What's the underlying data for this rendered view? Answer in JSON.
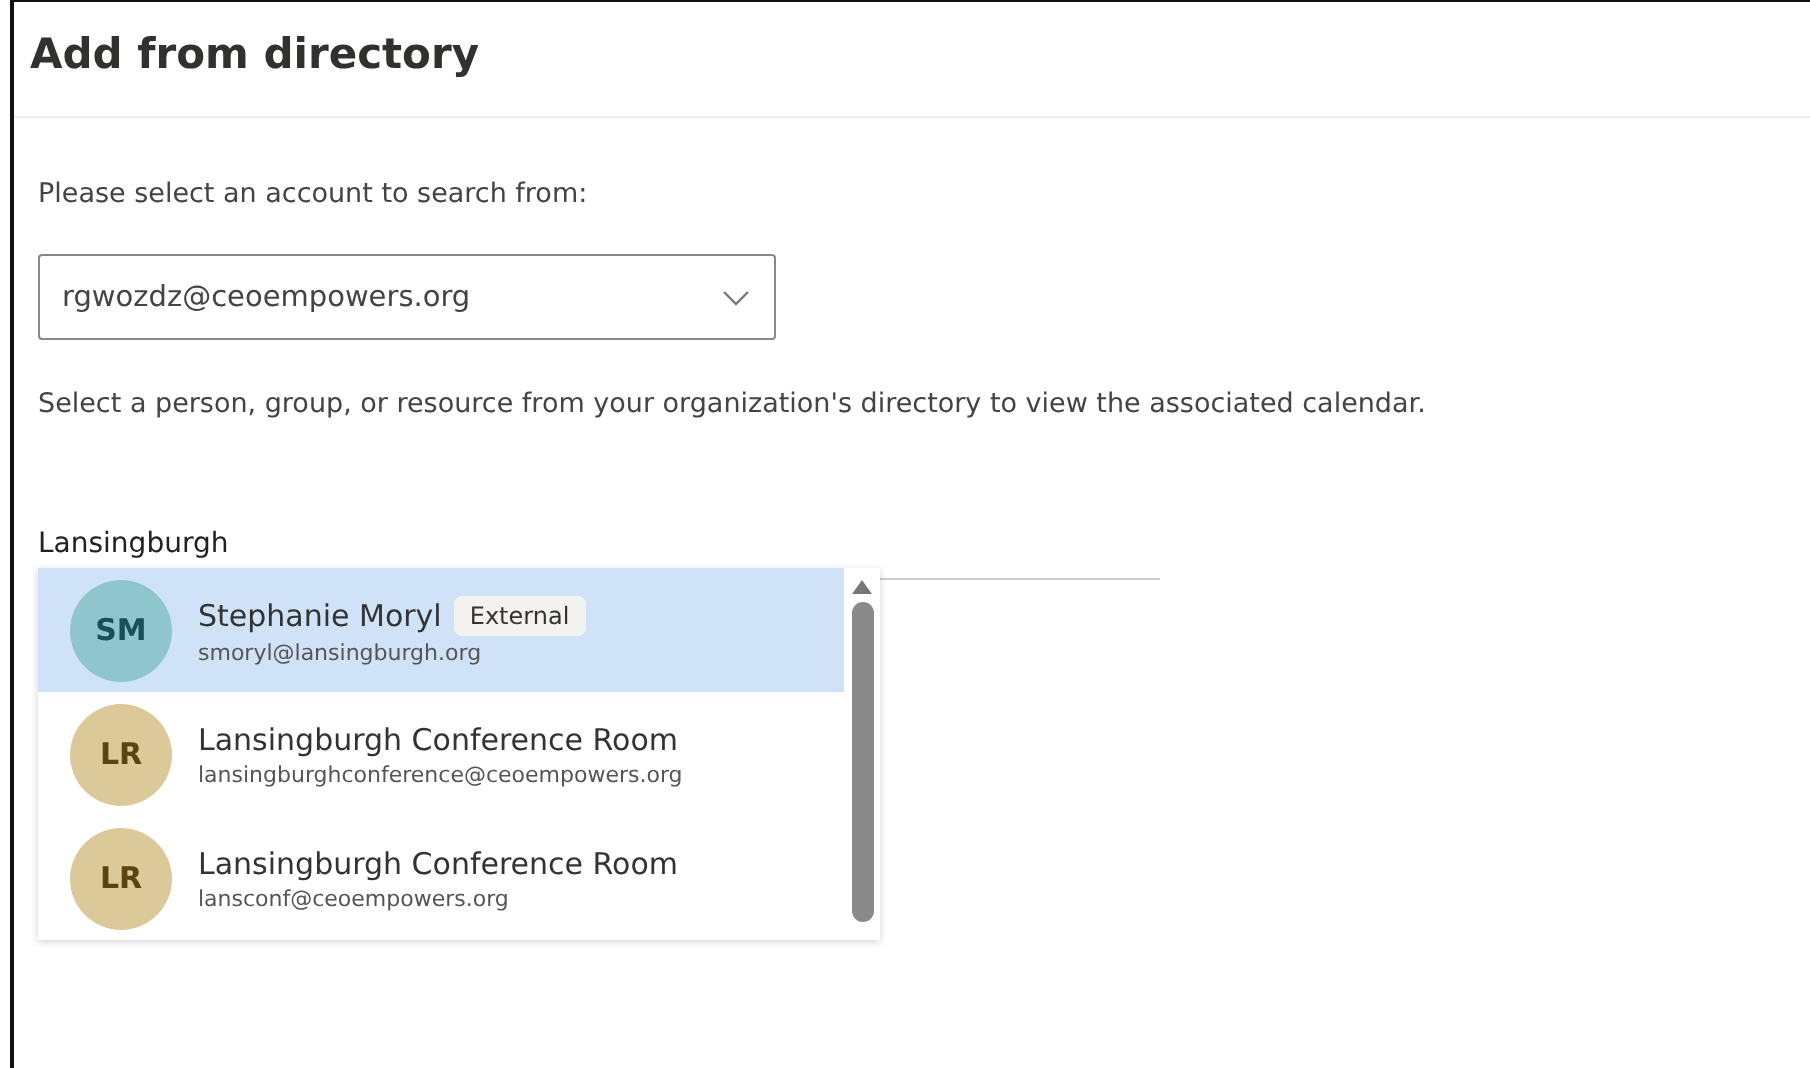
{
  "dialog": {
    "title": "Add from directory"
  },
  "account_label": "Please select an account to search from:",
  "account_select": {
    "value": "rgwozdz@ceoempowers.org"
  },
  "description": "Select a person, group, or resource from your organization's directory to view the associated calendar.",
  "search": {
    "value": "Lansingburgh"
  },
  "results": [
    {
      "initials": "SM",
      "name": "Stephanie Moryl",
      "badge": "External",
      "email": "smoryl@lansingburgh.org",
      "color": "#8fc5cc",
      "selected": true
    },
    {
      "initials": "LR",
      "name": "Lansingburgh Conference Room",
      "email": "lansingburghconference@ceoempowers.org",
      "color": "#dcc99a",
      "selected": false
    },
    {
      "initials": "LR",
      "name": "Lansingburgh Conference Room",
      "email": "lansconf@ceoempowers.org",
      "color": "#dcc99a",
      "selected": false
    }
  ]
}
